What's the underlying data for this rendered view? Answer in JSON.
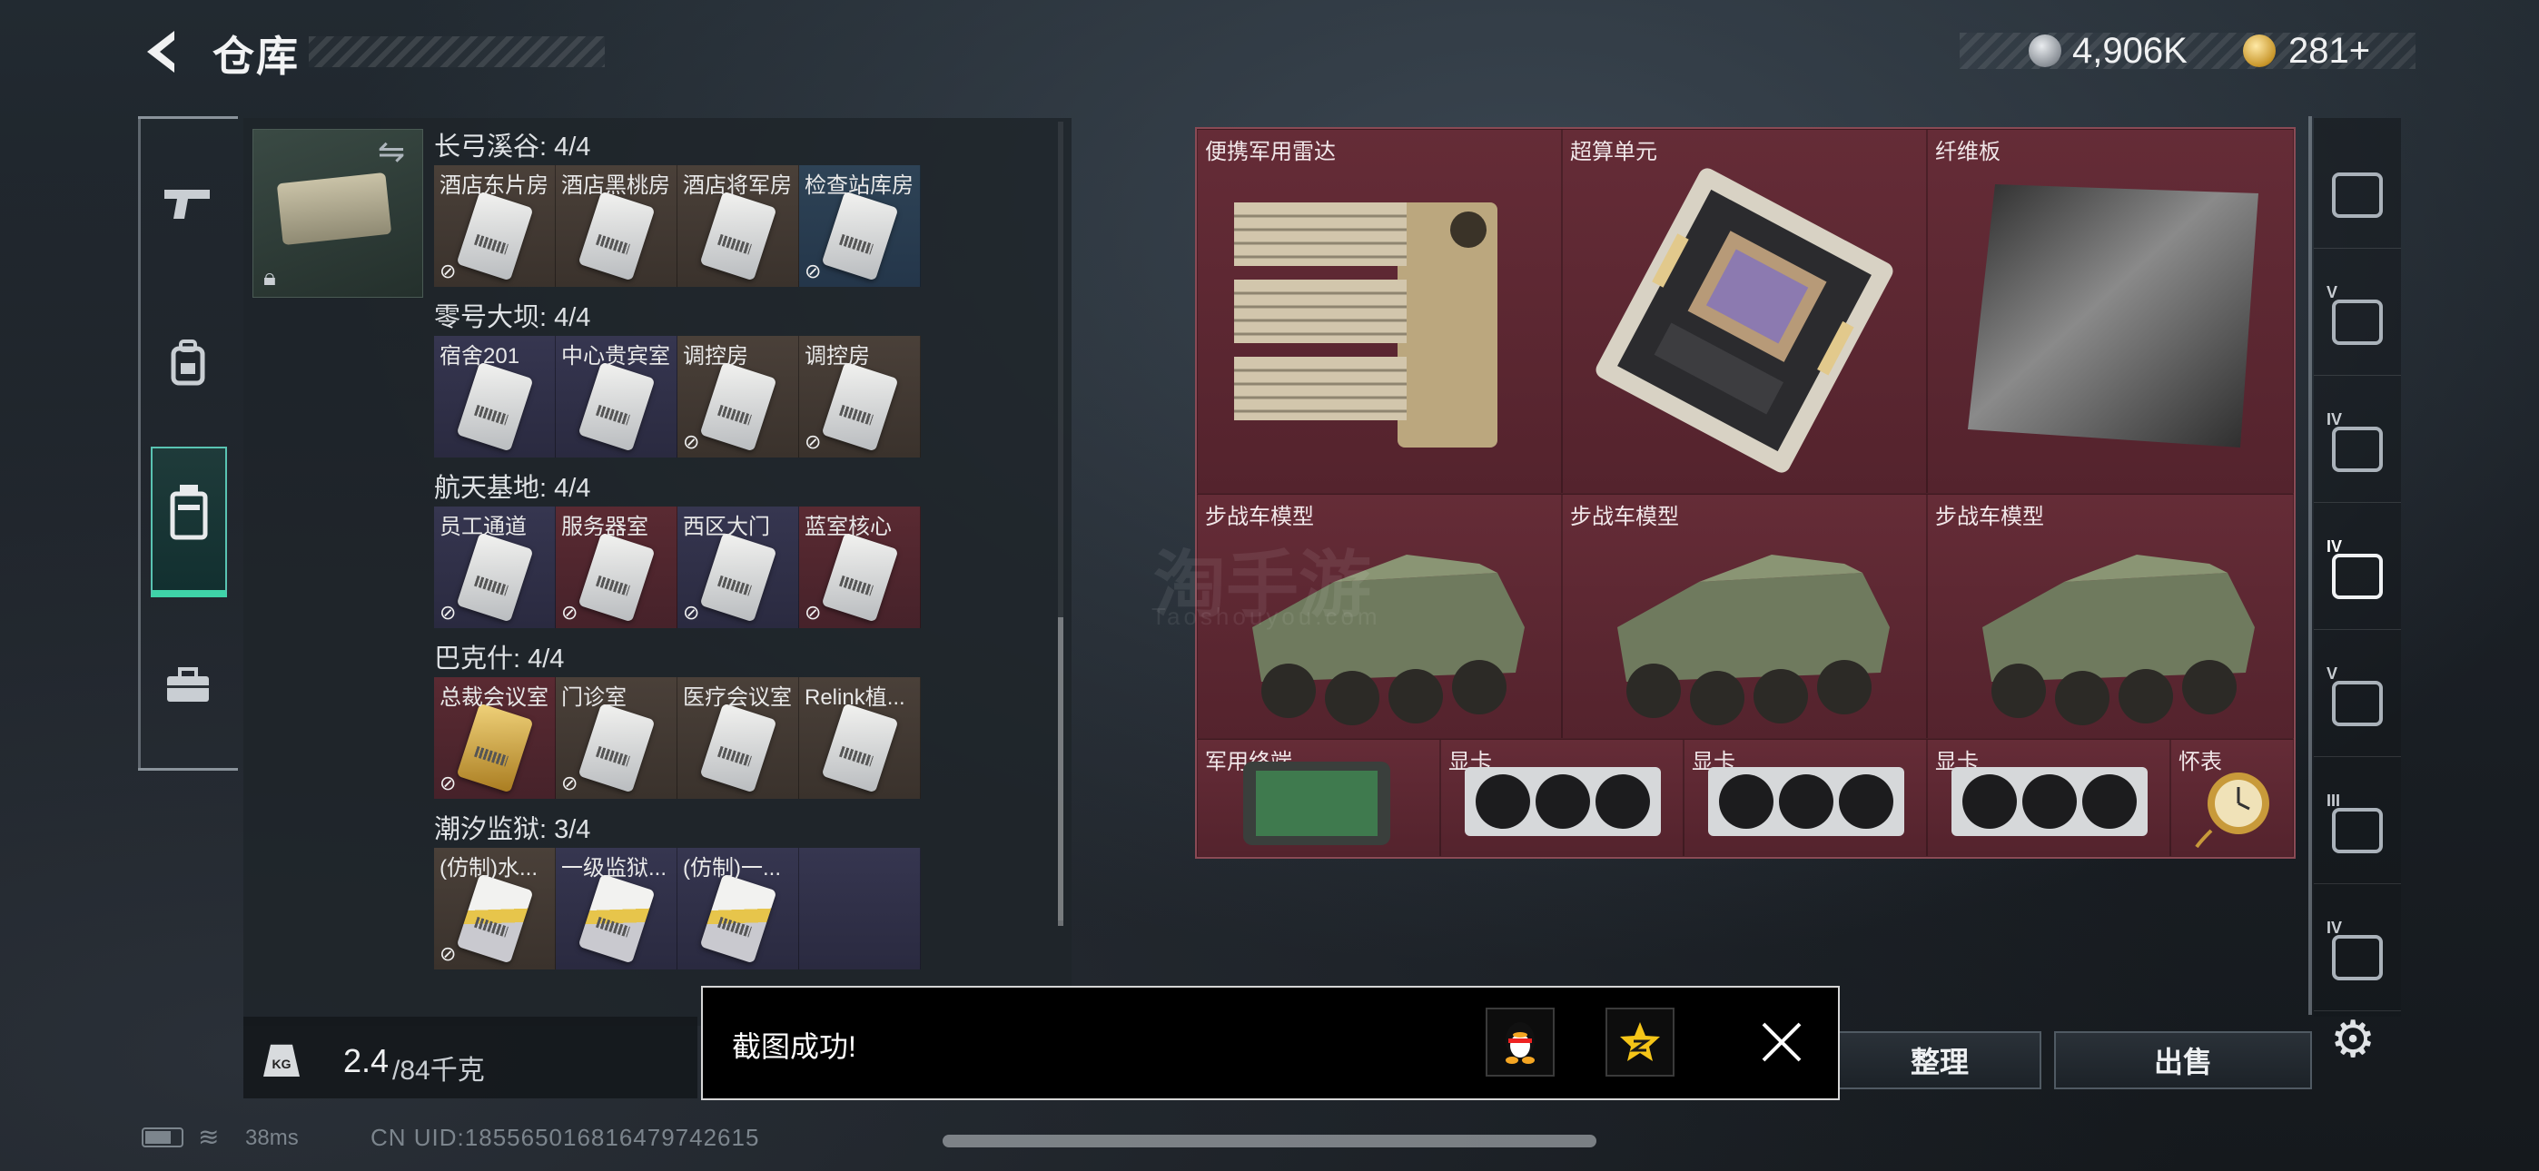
{
  "header": {
    "title": "仓库"
  },
  "currency": {
    "silver": "4,906K",
    "gold": "281+"
  },
  "left_rail": {
    "items": [
      {
        "name": "pistol-icon"
      },
      {
        "name": "backpack-icon"
      },
      {
        "name": "keycard-icon",
        "active": true
      },
      {
        "name": "briefcase-icon"
      }
    ]
  },
  "keychain": {
    "swap_icon": "swap-icon",
    "lock_icon": "lock-icon"
  },
  "sections": [
    {
      "label": "长弓溪谷: 4/4",
      "cards": [
        {
          "label": "酒店东片房",
          "color": "brown",
          "locked": true
        },
        {
          "label": "酒店黑桃房",
          "color": "brown",
          "locked": false
        },
        {
          "label": "酒店将军房",
          "color": "brown",
          "locked": false
        },
        {
          "label": "检查站库房",
          "color": "blue",
          "locked": true
        }
      ]
    },
    {
      "label": "零号大坝: 4/4",
      "cards": [
        {
          "label": "宿舍201",
          "color": "purple",
          "locked": false
        },
        {
          "label": "中心贵宾室",
          "color": "purple",
          "locked": false
        },
        {
          "label": "调控房",
          "color": "brown",
          "locked": true
        },
        {
          "label": "调控房",
          "color": "brown",
          "locked": true
        }
      ]
    },
    {
      "label": "航天基地: 4/4",
      "cards": [
        {
          "label": "员工通道",
          "color": "purple",
          "locked": true
        },
        {
          "label": "服务器室",
          "color": "red",
          "locked": true
        },
        {
          "label": "西区大门",
          "color": "purple",
          "locked": true
        },
        {
          "label": "蓝室核心",
          "color": "red",
          "locked": true
        }
      ]
    },
    {
      "label": "巴克什: 4/4",
      "cards": [
        {
          "label": "总裁会议室",
          "color": "red",
          "locked": true,
          "style": "gold"
        },
        {
          "label": "门诊室",
          "color": "brown",
          "locked": true
        },
        {
          "label": "医疗会议室",
          "color": "brown",
          "locked": false
        },
        {
          "label": "Relink植...",
          "color": "brown",
          "locked": false
        }
      ]
    },
    {
      "label": "潮汐监狱: 3/4",
      "cards": [
        {
          "label": "(仿制)水...",
          "color": "brown",
          "locked": true,
          "style": "stripe"
        },
        {
          "label": "一级监狱...",
          "color": "purple",
          "locked": false,
          "style": "stripe"
        },
        {
          "label": "(仿制)一...",
          "color": "purple",
          "locked": false,
          "style": "stripe"
        },
        {
          "label": "",
          "color": "purple",
          "locked": false,
          "empty": true
        }
      ]
    }
  ],
  "weight": {
    "current": "2.4",
    "capacity": "/84千克",
    "icon": "KG"
  },
  "items": [
    {
      "label": "便携军用雷达",
      "icon": "radar-icon"
    },
    {
      "label": "超算单元",
      "icon": "motherboard-icon"
    },
    {
      "label": "纤维板",
      "icon": "carbon-plate-icon"
    },
    {
      "label": "步战车模型",
      "icon": "ifv-model-icon"
    },
    {
      "label": "步战车模型",
      "icon": "ifv-model-icon"
    },
    {
      "label": "步战车模型",
      "icon": "ifv-model-icon"
    },
    {
      "label": "军用终端",
      "icon": "terminal-icon"
    },
    {
      "label": "显卡",
      "icon": "gpu-icon"
    },
    {
      "label": "显卡",
      "icon": "gpu-icon"
    },
    {
      "label": "显卡",
      "icon": "gpu-icon"
    },
    {
      "label": "怀表",
      "icon": "pocket-watch-icon"
    }
  ],
  "right_rail": [
    {
      "roman": "",
      "icon": "arch-icon"
    },
    {
      "roman": "V",
      "icon": "safe-icon"
    },
    {
      "roman": "IV",
      "icon": "safe-icon"
    },
    {
      "roman": "IV",
      "icon": "safe-icon",
      "active": true
    },
    {
      "roman": "V",
      "icon": "safe-icon"
    },
    {
      "roman": "III",
      "icon": "safe-icon"
    },
    {
      "roman": "IV",
      "icon": "safe-icon"
    }
  ],
  "buttons": {
    "sort": "整理",
    "sell": "出售"
  },
  "toast": {
    "message": "截图成功!"
  },
  "status": {
    "ping": "38ms",
    "uid": "CN UID:185565016816479742615"
  },
  "watermark": {
    "cn": "淘手游",
    "en": "Taoshouyou.com"
  },
  "colors": {
    "accent": "#3fd3a8",
    "item_bg": "#5a2630"
  }
}
